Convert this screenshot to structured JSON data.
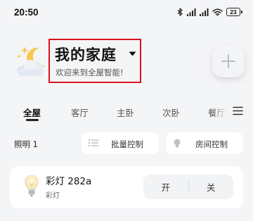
{
  "status_bar": {
    "time": "20:50",
    "battery": "23",
    "icons": [
      "bluetooth-icon",
      "signal-icon",
      "signal-icon",
      "wifi-icon",
      "battery-icon"
    ]
  },
  "header": {
    "title": "我的家庭",
    "subtitle": "欢迎来到全屋智能!",
    "weather_icon": "moon-cloud-icon",
    "dropdown_icon": "caret-down-icon",
    "add_icon": "plus-icon"
  },
  "tabs": {
    "items": [
      {
        "label": "全屋",
        "active": true
      },
      {
        "label": "客厅",
        "active": false
      },
      {
        "label": "主卧",
        "active": false
      },
      {
        "label": "次卧",
        "active": false
      },
      {
        "label": "餐厅",
        "active": false
      }
    ],
    "menu_icon": "menu-icon"
  },
  "section": {
    "label": "照明 1",
    "batch_control_label": "批量控制",
    "room_control_label": "房间控制"
  },
  "device": {
    "name": "彩灯 282a",
    "type": "彩灯",
    "on_label": "开",
    "off_label": "关",
    "icon": "bulb-icon"
  },
  "colors": {
    "background": "#f4f5f7",
    "highlight_border": "#d8141e",
    "card": "#ffffff"
  }
}
